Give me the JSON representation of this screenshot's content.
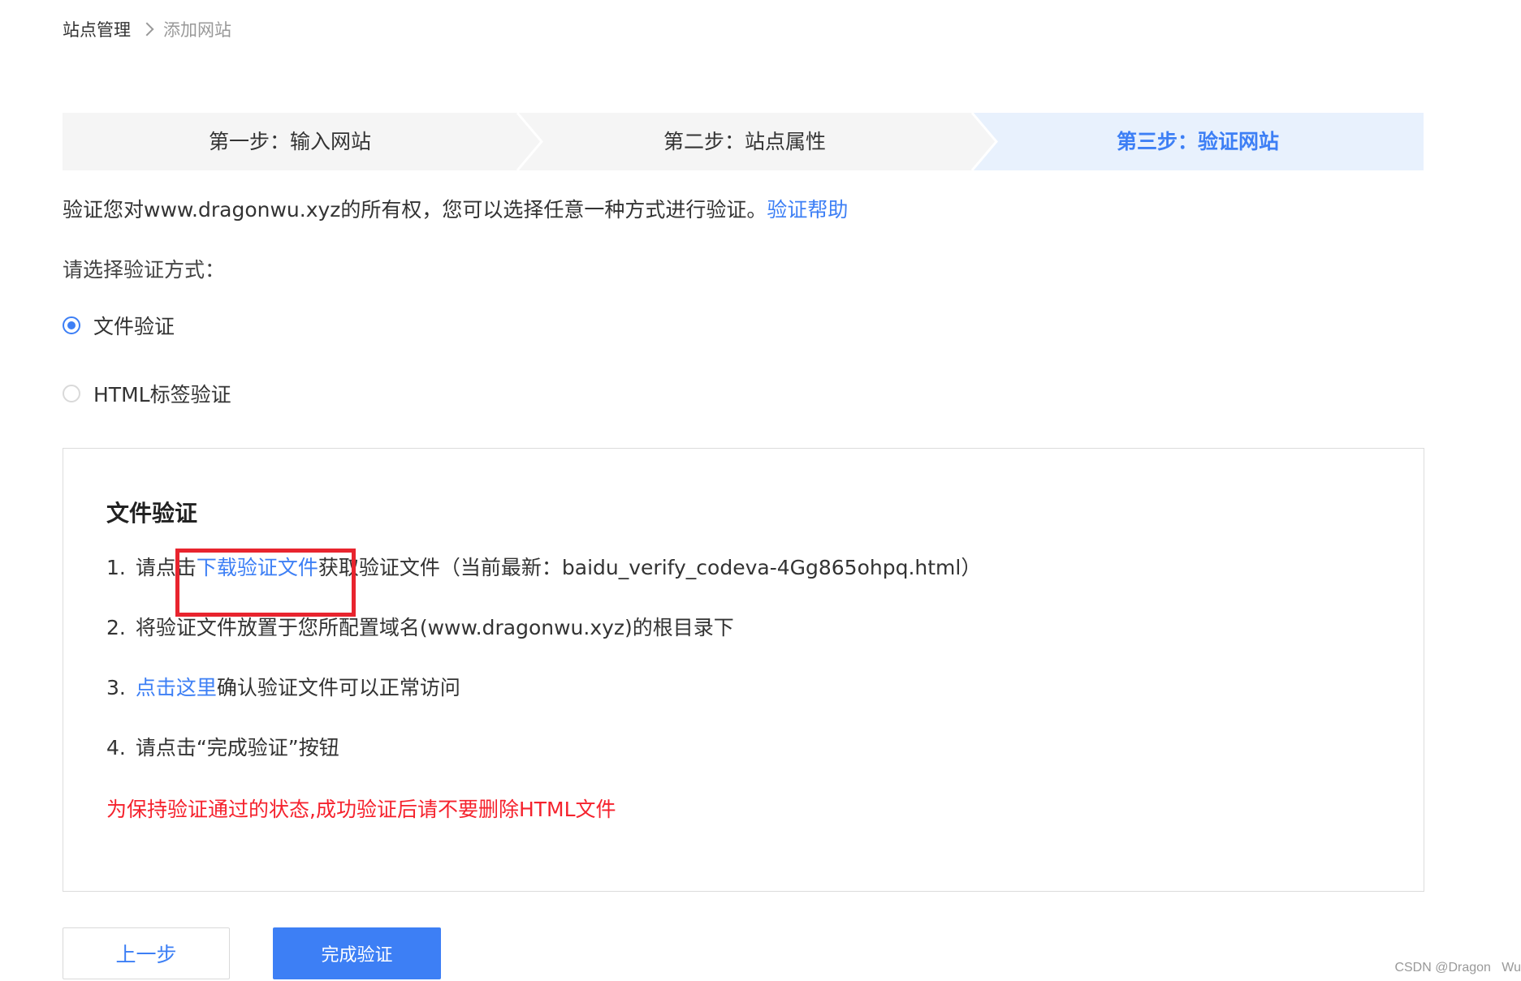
{
  "breadcrumb": {
    "root": "站点管理",
    "current": "添加网站"
  },
  "steps": [
    {
      "label": "第一步：输入网站",
      "active": false
    },
    {
      "label": "第二步：站点属性",
      "active": false
    },
    {
      "label": "第三步：验证网站",
      "active": true
    }
  ],
  "description": {
    "text": "验证您对www.dragonwu.xyz的所有权，您可以选择任意一种方式进行验证。",
    "help_link": "验证帮助"
  },
  "choose_method_label": "请选择验证方式：",
  "methods": [
    {
      "label": "文件验证",
      "selected": true
    },
    {
      "label": "HTML标签验证",
      "selected": false
    }
  ],
  "panel": {
    "title": "文件验证",
    "steps": [
      {
        "num": "1.",
        "prefix": "请点击",
        "link": "下载验证文件",
        "suffix": "获取验证文件（当前最新：baidu_verify_codeva-4Gg865ohpq.html）"
      },
      {
        "num": "2.",
        "text": "将验证文件放置于您所配置域名(www.dragonwu.xyz)的根目录下"
      },
      {
        "num": "3.",
        "link": "点击这里",
        "suffix": "确认验证文件可以正常访问"
      },
      {
        "num": "4.",
        "text": "请点击“完成验证”按钮"
      }
    ],
    "warning": "为保持验证通过的状态,成功验证后请不要删除HTML文件"
  },
  "buttons": {
    "prev": "上一步",
    "finish": "完成验证"
  },
  "watermark": "CSDN @Dragon   Wu",
  "colors": {
    "accent": "#3d7ff5",
    "warning": "#f5222d",
    "highlight": "#e8242e",
    "step_inactive_bg": "#f5f5f5",
    "step_active_bg": "#e8f1fd"
  }
}
